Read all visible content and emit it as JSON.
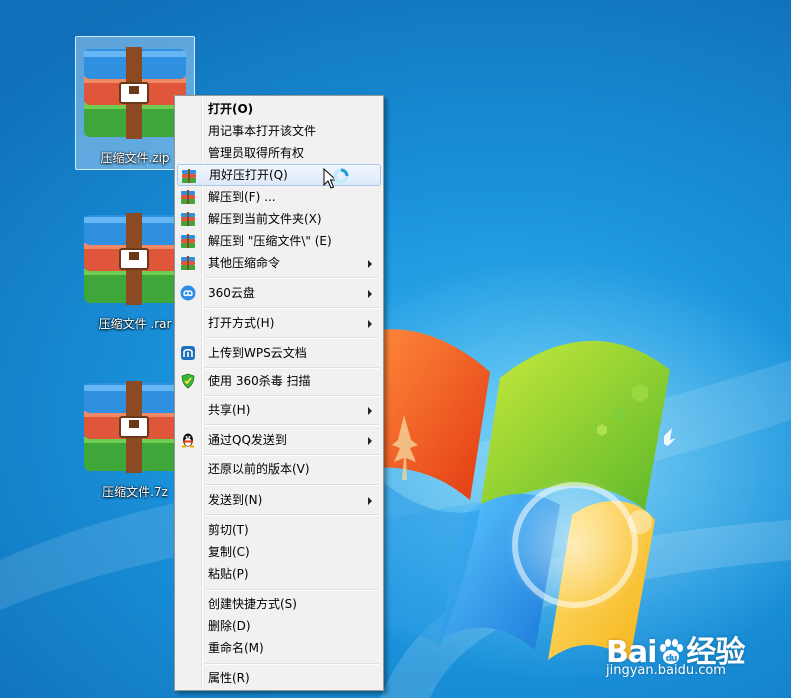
{
  "desktop": {
    "icons": [
      {
        "label": "压缩文件.zip"
      },
      {
        "label": "压缩文件 .rar"
      },
      {
        "label": "压缩文件.7z"
      }
    ]
  },
  "context_menu": {
    "items": {
      "open": "打开(O)",
      "open_notepad": "用记事本打开该文件",
      "take_ownership": "管理员取得所有权",
      "open_haozip": "用好压打开(Q)",
      "extract_to": "解压到(F) ...",
      "extract_here": "解压到当前文件夹(X)",
      "extract_named": "解压到 \"压缩文件\\\" (E)",
      "more_compress": "其他压缩命令",
      "cloud_360": "360云盘",
      "open_with": "打开方式(H)",
      "upload_wps": "上传到WPS云文档",
      "scan_360": "使用 360杀毒 扫描",
      "share": "共享(H)",
      "send_qq": "通过QQ发送到",
      "restore_versions": "还原以前的版本(V)",
      "send_to": "发送到(N)",
      "cut": "剪切(T)",
      "copy": "复制(C)",
      "paste": "粘贴(P)",
      "create_shortcut": "创建快捷方式(S)",
      "delete": "删除(D)",
      "rename": "重命名(M)",
      "properties": "属性(R)"
    }
  },
  "watermark": {
    "brand_left": "Bai",
    "brand_right": "经验",
    "url": "jingyan.baidu.com"
  }
}
